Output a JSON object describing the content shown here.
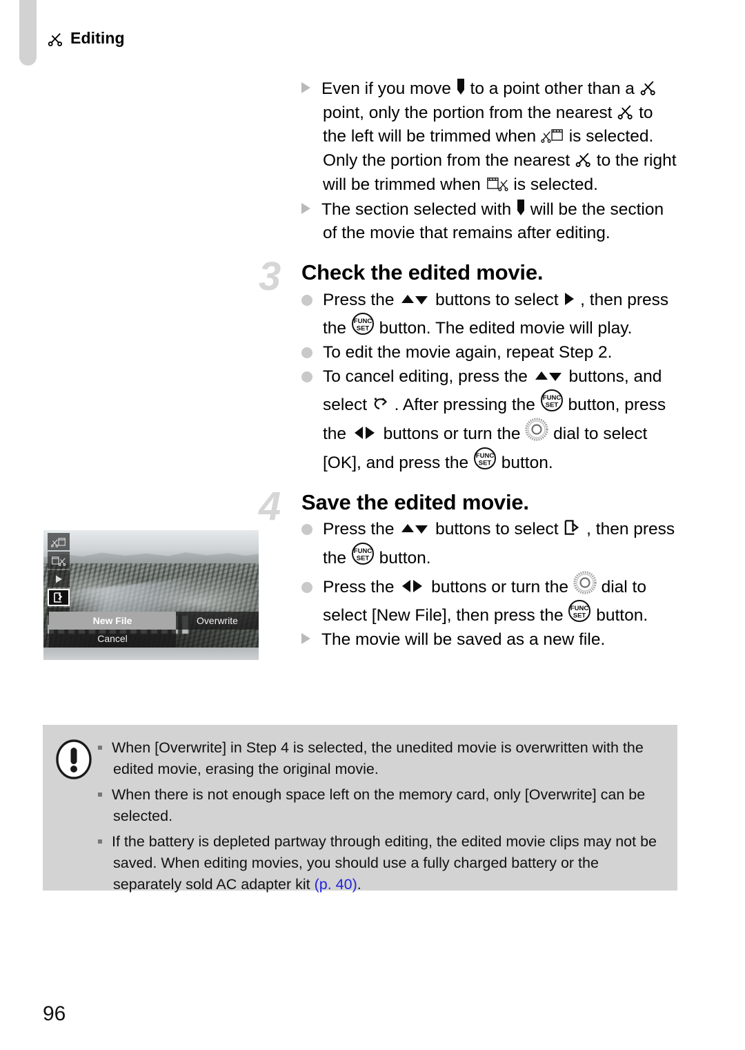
{
  "header": {
    "icon": "scissors-icon",
    "title": "Editing"
  },
  "notes_top": [
    {
      "bullet": "triangle-bullet",
      "segments": [
        {
          "t": "text",
          "v": "Even if you move "
        },
        {
          "t": "icon",
          "v": "edit-marker-icon"
        },
        {
          "t": "text",
          "v": " to a point other than a "
        },
        {
          "t": "icon",
          "v": "scissors-icon"
        },
        {
          "t": "text",
          "v": " point, only the portion from the nearest "
        },
        {
          "t": "icon",
          "v": "scissors-icon"
        },
        {
          "t": "text",
          "v": " to the left will be trimmed when "
        },
        {
          "t": "icon",
          "v": "trim-left-icon"
        },
        {
          "t": "text",
          "v": " is selected. Only the portion from the nearest "
        },
        {
          "t": "icon",
          "v": "scissors-icon"
        },
        {
          "t": "text",
          "v": " to the right will be trimmed when "
        },
        {
          "t": "icon",
          "v": "trim-right-icon"
        },
        {
          "t": "text",
          "v": " is selected."
        }
      ]
    },
    {
      "bullet": "triangle-bullet",
      "segments": [
        {
          "t": "text",
          "v": "The section selected with "
        },
        {
          "t": "icon",
          "v": "edit-marker-icon"
        },
        {
          "t": "text",
          "v": " will be the section of the movie that remains after editing."
        }
      ]
    }
  ],
  "steps": [
    {
      "number": "3",
      "heading": "Check the edited movie.",
      "bullets": [
        {
          "bullet": "dot-bullet",
          "segments": [
            {
              "t": "text",
              "v": "Press the "
            },
            {
              "t": "icon",
              "v": "up-down-buttons-icon"
            },
            {
              "t": "text",
              "v": " buttons to select "
            },
            {
              "t": "icon",
              "v": "play-icon"
            },
            {
              "t": "text",
              "v": " , then press the "
            },
            {
              "t": "icon",
              "v": "func-set-button-icon"
            },
            {
              "t": "text",
              "v": " button. The edited movie will play."
            }
          ]
        },
        {
          "bullet": "dot-bullet",
          "segments": [
            {
              "t": "text",
              "v": "To edit the movie again, repeat Step 2."
            }
          ]
        },
        {
          "bullet": "dot-bullet",
          "segments": [
            {
              "t": "text",
              "v": "To cancel editing, press the "
            },
            {
              "t": "icon",
              "v": "up-down-buttons-icon"
            },
            {
              "t": "text",
              "v": " buttons, and select "
            },
            {
              "t": "icon",
              "v": "return-icon"
            },
            {
              "t": "text",
              "v": " . After pressing the "
            },
            {
              "t": "icon",
              "v": "func-set-button-icon"
            },
            {
              "t": "text",
              "v": " button, press the "
            },
            {
              "t": "icon",
              "v": "left-right-buttons-icon"
            },
            {
              "t": "text",
              "v": " buttons or turn the "
            },
            {
              "t": "icon",
              "v": "control-dial-icon"
            },
            {
              "t": "text",
              "v": " dial to select [OK], and press the "
            },
            {
              "t": "icon",
              "v": "func-set-button-icon"
            },
            {
              "t": "text",
              "v": " button."
            }
          ]
        }
      ],
      "sub_notes": []
    },
    {
      "number": "4",
      "heading": "Save the edited movie.",
      "bullets": [
        {
          "bullet": "dot-bullet",
          "segments": [
            {
              "t": "text",
              "v": "Press the "
            },
            {
              "t": "icon",
              "v": "up-down-buttons-icon"
            },
            {
              "t": "text",
              "v": " buttons to select "
            },
            {
              "t": "icon",
              "v": "save-file-icon"
            },
            {
              "t": "text",
              "v": " , then press the "
            },
            {
              "t": "icon",
              "v": "func-set-button-icon"
            },
            {
              "t": "text",
              "v": " button."
            }
          ]
        },
        {
          "bullet": "dot-bullet",
          "segments": [
            {
              "t": "text",
              "v": "Press the "
            },
            {
              "t": "icon",
              "v": "left-right-buttons-icon"
            },
            {
              "t": "text",
              "v": " buttons or turn the "
            },
            {
              "t": "icon",
              "v": "control-dial-icon"
            },
            {
              "t": "text",
              "v": " dial to select [New File], then press the "
            },
            {
              "t": "icon",
              "v": "func-set-button-icon"
            },
            {
              "t": "text",
              "v": " button."
            }
          ]
        }
      ],
      "sub_notes": [
        {
          "bullet": "triangle-bullet",
          "segments": [
            {
              "t": "text",
              "v": "The movie will be saved as a new file."
            }
          ]
        }
      ]
    }
  ],
  "figure": {
    "name": "camera-screen-save-dialog",
    "sidebar_icons": [
      "trim-left-icon",
      "trim-right-icon",
      "play-icon",
      "save-file-icon",
      "return-icon"
    ],
    "selected_sidebar_icon": "save-file-icon",
    "options": {
      "new_file": "New File",
      "overwrite": "Overwrite",
      "cancel": "Cancel"
    },
    "selected_option": "New File"
  },
  "caution": {
    "icon": "exclamation-icon",
    "background": "#d3d3d3",
    "items": [
      {
        "segments": [
          {
            "t": "text",
            "v": "When [Overwrite] in Step 4 is selected, the unedited movie is overwritten with the edited movie, erasing the original movie."
          }
        ]
      },
      {
        "segments": [
          {
            "t": "text",
            "v": "When there is not enough space left on the memory card, only [Overwrite] can be selected."
          }
        ]
      },
      {
        "segments": [
          {
            "t": "text",
            "v": "If the battery is depleted partway through editing, the edited movie clips may not be saved. When editing movies, you should use a fully charged battery or the separately sold AC adapter kit "
          },
          {
            "t": "link",
            "v": "(p. 40)"
          },
          {
            "t": "text",
            "v": "."
          }
        ]
      }
    ]
  },
  "page_number": "96",
  "colors": {
    "link": "#2222dd",
    "caution_bg": "#d3d3d3",
    "step_number": "#d6d6d6",
    "dot_bullet": "#c9c9c9",
    "triangle_bullet": "#b9b9b9"
  }
}
